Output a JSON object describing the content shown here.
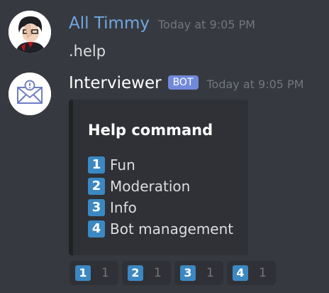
{
  "messages": [
    {
      "author": "All Timmy",
      "timestamp": "Today at 9:05 PM",
      "content": ".help",
      "avatar_icon": "person-avatar"
    },
    {
      "author": "Interviewer",
      "badge": "BOT",
      "timestamp": "Today at 9:05 PM",
      "avatar_icon": "envelope-alert-icon"
    }
  ],
  "embed": {
    "title": "Help command",
    "items": [
      {
        "key": "1",
        "label": "Fun"
      },
      {
        "key": "2",
        "label": "Moderation"
      },
      {
        "key": "3",
        "label": "Info"
      },
      {
        "key": "4",
        "label": "Bot management"
      }
    ]
  },
  "reactions": [
    {
      "emoji": "1",
      "count": "1"
    },
    {
      "emoji": "2",
      "count": "1"
    },
    {
      "emoji": "3",
      "count": "1"
    },
    {
      "emoji": "4",
      "count": "1"
    }
  ],
  "colors": {
    "background": "#36393f",
    "embed_background": "#2f3136",
    "user_name": "#71a6e0",
    "bot_badge": "#7289da",
    "keycap": "#3b88c3",
    "timestamp": "#72767d"
  }
}
